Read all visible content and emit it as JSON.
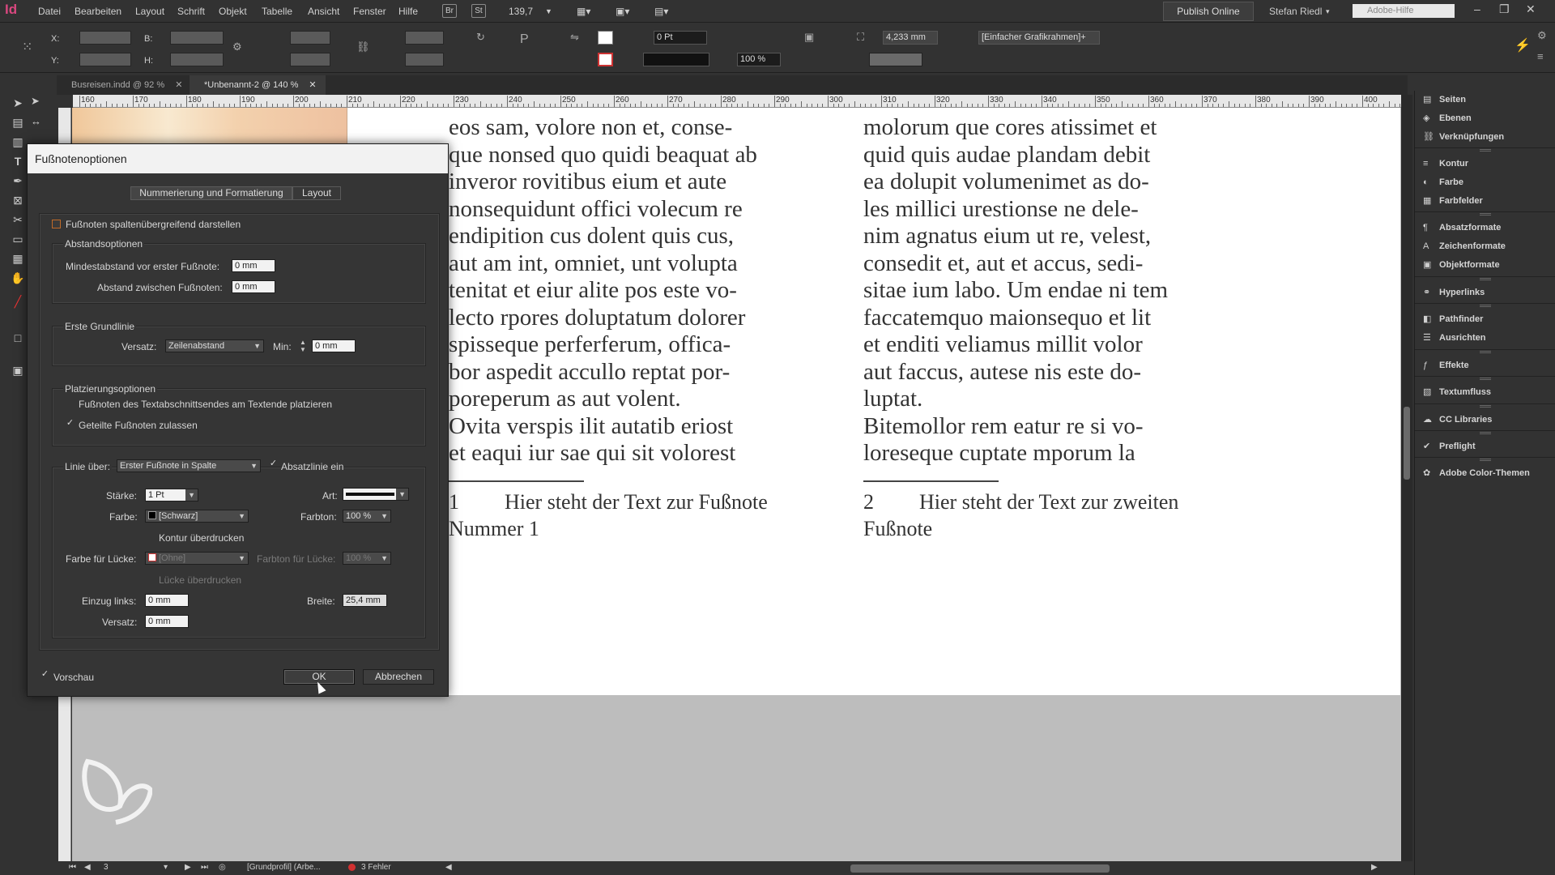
{
  "app": {
    "logo": "Id",
    "menu": [
      "Datei",
      "Bearbeiten",
      "Layout",
      "Schrift",
      "Objekt",
      "Tabelle",
      "Ansicht",
      "Fenster",
      "Hilfe"
    ],
    "bridge_label": "Br",
    "stock_label": "St",
    "zoom": "139,7",
    "publish_label": "Publish Online",
    "user": "Stefan Riedl",
    "search_placeholder": "Adobe-Hilfe"
  },
  "control": {
    "x_label": "X:",
    "y_label": "Y:",
    "b_label": "B:",
    "h_label": "H:",
    "stroke_weight": "0 Pt",
    "scale": "100 %",
    "frame_dim": "4,233 mm",
    "object_style": "[Einfacher Grafikrahmen]+"
  },
  "tabs": [
    {
      "label": "Busreisen.indd @ 92 %"
    },
    {
      "label": "*Unbenannt-2 @ 140 %"
    }
  ],
  "ruler": {
    "marks": [
      "160",
      "170",
      "180",
      "190",
      "200",
      "210",
      "220",
      "230",
      "240",
      "250",
      "260",
      "270",
      "280",
      "290",
      "300",
      "310",
      "320",
      "330",
      "340",
      "350",
      "360",
      "370",
      "380",
      "390",
      "400"
    ]
  },
  "document": {
    "col1": [
      "eos sam, volore non et, conse-",
      "que nonsed quo quidi beaquat ab",
      "inveror rovitibus eium et aute",
      "nonsequidunt offici volecum re",
      "endipition cus dolent quis cus,",
      "aut am int, omniet, unt volupta",
      "tenitat et eiur alite pos este vo-",
      "lecto rpores doluptatum dolorer",
      "spisseque perferferum, offica-",
      "bor aspedit accullo reptat por-",
      "poreperum as aut volent.",
      "Ovita verspis ilit autatib eriost",
      "et eaqui iur sae qui sit volorest"
    ],
    "col2": [
      "molorum que cores atissimet et",
      "quid quis audae plandam debit",
      "ea dolupit volumenimet as do-",
      "les millici urestionse ne dele-",
      "nim agnatus eium ut re, velest,",
      "consedit et, aut et accus, sedi-",
      "sitae ium labo. Um endae ni tem",
      "faccatemquo maionsequo et lit",
      "et enditi veliamus millit volor",
      "aut faccus, autese nis este do-",
      "luptat.",
      "Bitemollor rem eatur re si vo-",
      "loreseque cuptate mporum la"
    ],
    "footnote1_num": "1",
    "footnote1_line1": "Hier steht der Text zur Fußnote",
    "footnote1_line2": "Nummer 1",
    "footnote2_num": "2",
    "footnote2_line1": "Hier steht der Text zur zweiten",
    "footnote2_line2": "Fußnote"
  },
  "status": {
    "page": "3",
    "profile": "[Grundprofil] (Arbe...",
    "errors": "3 Fehler"
  },
  "panels": [
    {
      "label": "Seiten",
      "icon": "pages-icon"
    },
    {
      "label": "Ebenen",
      "icon": "layers-icon"
    },
    {
      "label": "Verknüpfungen",
      "icon": "links-icon"
    },
    {
      "label": "Kontur",
      "icon": "stroke-icon"
    },
    {
      "label": "Farbe",
      "icon": "color-icon"
    },
    {
      "label": "Farbfelder",
      "icon": "swatches-icon"
    },
    {
      "label": "Absatzformate",
      "icon": "paragraph-styles-icon"
    },
    {
      "label": "Zeichenformate",
      "icon": "character-styles-icon"
    },
    {
      "label": "Objektformate",
      "icon": "object-styles-icon"
    },
    {
      "label": "Hyperlinks",
      "icon": "hyperlinks-icon"
    },
    {
      "label": "Pathfinder",
      "icon": "pathfinder-icon"
    },
    {
      "label": "Ausrichten",
      "icon": "align-icon"
    },
    {
      "label": "Effekte",
      "icon": "effects-icon"
    },
    {
      "label": "Textumfluss",
      "icon": "text-wrap-icon"
    },
    {
      "label": "CC Libraries",
      "icon": "cc-libraries-icon"
    },
    {
      "label": "Preflight",
      "icon": "preflight-icon"
    },
    {
      "label": "Adobe Color-Themen",
      "icon": "color-themes-icon"
    }
  ],
  "dialog": {
    "title": "Fußnotenoptionen",
    "tab1": "Nummerierung und Formatierung",
    "tab2": "Layout",
    "span_columns": "Fußnoten spaltenübergreifend darstellen",
    "spacing_group": "Abstandsoptionen",
    "min_space_label": "Mindestabstand vor erster Fußnote:",
    "min_space_value": "0 mm",
    "between_label": "Abstand zwischen Fußnoten:",
    "between_value": "0 mm",
    "baseline_group": "Erste Grundlinie",
    "offset_label": "Versatz:",
    "offset_value": "Zeilenabstand",
    "min_label": "Min:",
    "min_value": "0 mm",
    "placement_group": "Platzierungsoptionen",
    "place_end": "Fußnoten des Textabschnittsendes am Textende platzieren",
    "allow_split": "Geteilte Fußnoten zulassen",
    "rule_above_label": "Linie über:",
    "rule_above_value": "Erster Fußnote in Spalte",
    "rule_on": "Absatzlinie ein",
    "weight_label": "Stärke:",
    "weight_value": "1 Pt",
    "type_label": "Art:",
    "color_label": "Farbe:",
    "color_value": "[Schwarz]",
    "tint_label": "Farbton:",
    "tint_value": "100 %",
    "overprint_stroke": "Kontur überdrucken",
    "gap_color_label": "Farbe für Lücke:",
    "gap_color_value": "[Ohne]",
    "gap_tint_label": "Farbton für Lücke:",
    "gap_tint_value": "100 %",
    "overprint_gap": "Lücke überdrucken",
    "left_indent_label": "Einzug links:",
    "left_indent_value": "0 mm",
    "width_label": "Breite:",
    "width_value": "25,4 mm",
    "offset2_label": "Versatz:",
    "offset2_value": "0 mm",
    "preview_label": "Vorschau",
    "ok_label": "OK",
    "cancel_label": "Abbrechen"
  },
  "colors": {
    "ui_bg": "#323232",
    "accent_logo": "#d9477f",
    "error_dot": "#d03030"
  }
}
